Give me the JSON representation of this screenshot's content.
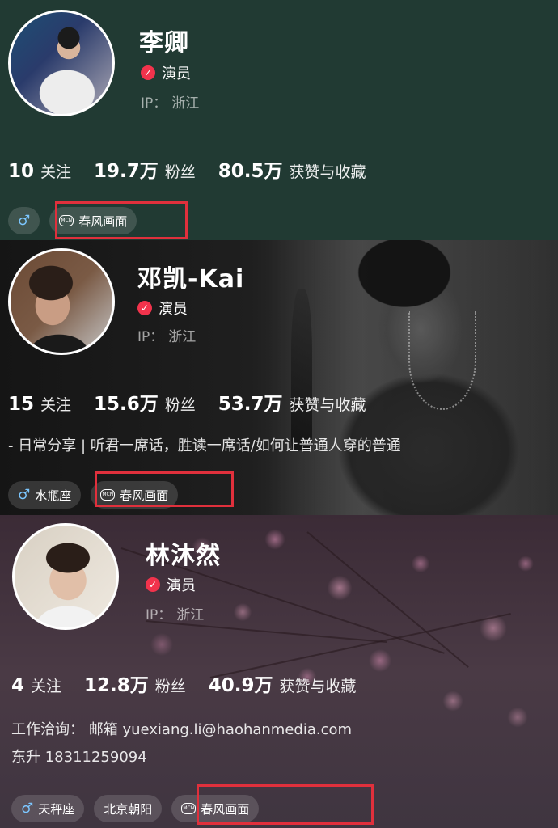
{
  "profiles": [
    {
      "name": "李卿",
      "role": "演员",
      "ip_label": "IP：",
      "ip_value": "浙江",
      "follow_count": "10",
      "follow_label": "关注",
      "fans_count": "19.7万",
      "fans_label": "粉丝",
      "likes_count": "80.5万",
      "likes_label": "获赞与收藏",
      "tags": {
        "gender": "♂",
        "mcn": "春风画面"
      }
    },
    {
      "name": "邓凯-Kai",
      "role": "演员",
      "ip_label": "IP：",
      "ip_value": "浙江",
      "follow_count": "15",
      "follow_label": "关注",
      "fans_count": "15.6万",
      "fans_label": "粉丝",
      "likes_count": "53.7万",
      "likes_label": "获赞与收藏",
      "bio": "- 日常分享 | 听君一席话，胜读一席话/如何让普通人穿的普通",
      "tags": {
        "gender": "♂",
        "zodiac": "水瓶座",
        "mcn": "春风画面"
      }
    },
    {
      "name": "林沐然",
      "role": "演员",
      "ip_label": "IP：",
      "ip_value": "浙江",
      "follow_count": "4",
      "follow_label": "关注",
      "fans_count": "12.8万",
      "fans_label": "粉丝",
      "likes_count": "40.9万",
      "likes_label": "获赞与收藏",
      "bio_line1": "工作洽询： 邮箱  yuexiang.li@haohanmedia.com",
      "bio_line2": "东升 18311259094",
      "tags": {
        "gender": "♂",
        "zodiac": "天秤座",
        "location": "北京朝阳",
        "mcn": "春风画面"
      }
    }
  ],
  "icons": {
    "verified": "check-icon",
    "mcn": "mcn-icon",
    "male": "male-icon"
  },
  "mcn_icon_text": "MCN",
  "check_glyph": "✓",
  "colors": {
    "verified": "#f2334c",
    "highlight_box": "#e0303c",
    "male": "#7cc7ff"
  }
}
